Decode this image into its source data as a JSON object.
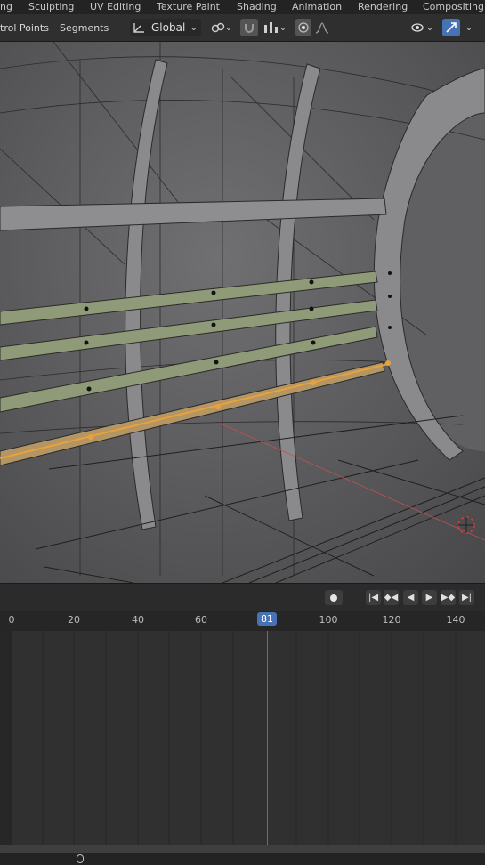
{
  "workspace_tabs": [
    "ng",
    "Sculpting",
    "UV Editing",
    "Texture Paint",
    "Shading",
    "Animation",
    "Rendering",
    "Compositing"
  ],
  "header": {
    "control_points": "trol Points",
    "segments": "Segments",
    "transform_orientation": "Global"
  },
  "timeline": {
    "ticks": [
      "0",
      "20",
      "40",
      "60",
      "100",
      "120",
      "140"
    ],
    "current_frame": "81"
  },
  "colors": {
    "accent": "#4772b3",
    "selected_curve": "#e8a23a",
    "viewport_bg": "#5c5c5e"
  }
}
